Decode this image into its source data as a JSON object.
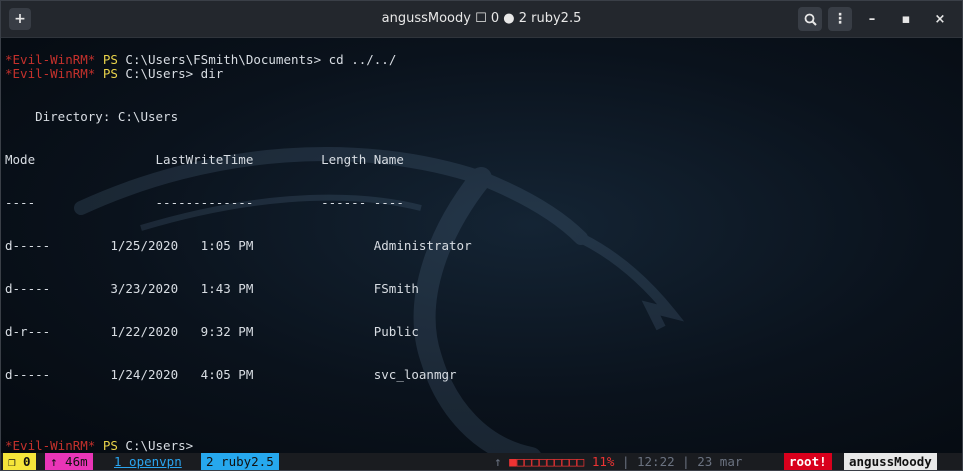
{
  "window": {
    "new_tab_icon": "+",
    "title": "angussMoody ☐ 0 ● 2 ruby2.5",
    "search_icon": "🔍",
    "menu_icon": "⋮",
    "minimize": "–",
    "maximize": "▪",
    "close": "×"
  },
  "terminal": {
    "prompt_shell": "*Evil-WinRM*",
    "prompt_ps": " PS ",
    "lines": [
      {
        "path": "C:\\Users\\FSmith\\Documents>",
        "cmd": " cd ../../"
      },
      {
        "path": "C:\\Users>",
        "cmd": " dir"
      }
    ],
    "directory_label": "    Directory: C:\\Users",
    "header": "Mode                LastWriteTime         Length Name",
    "separator": "----                -------------         ------ ----",
    "rows": [
      "d-----        1/25/2020   1:05 PM                Administrator",
      "d-----        3/23/2020   1:43 PM                FSmith",
      "d-r---        1/22/2020   9:32 PM                Public",
      "d-----        1/24/2020   4:05 PM                svc_loanmgr"
    ],
    "final_prompt_path": "C:\\Users>"
  },
  "statusbar": {
    "session": "❐ 0",
    "uptime": "↑ 46m",
    "window1": "1 openvpn",
    "window2": "2 ruby2.5",
    "upload": "↑ ",
    "battery_bar": "■□□□□□□□□□ 11%",
    "separator1": " | ",
    "time": "12:22",
    "separator2": " | ",
    "date": "23 mar",
    "root": "root!",
    "user": "angussMoody"
  },
  "colors": {
    "prompt_red": "#c5312c",
    "prompt_yellow": "#e8d24a",
    "tab_yellow": "#f5e53a",
    "tab_magenta": "#ea35b7",
    "tab_blue": "#26a8ee",
    "root_red": "#d9001c"
  }
}
